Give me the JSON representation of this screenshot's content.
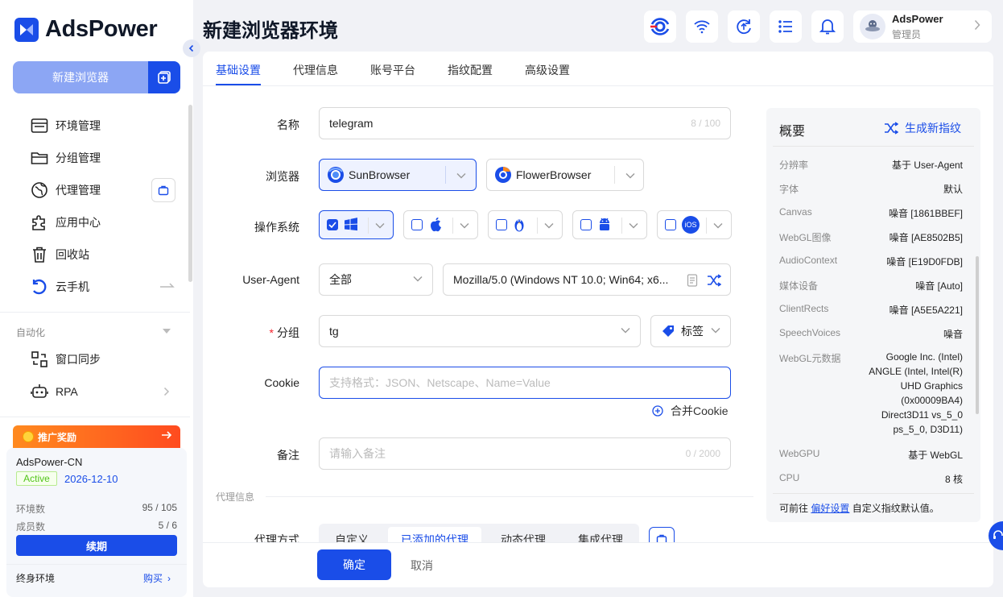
{
  "app": {
    "name": "AdsPower"
  },
  "sidebar": {
    "new_browser_label": "新建浏览器",
    "items": [
      {
        "label": "环境管理"
      },
      {
        "label": "分组管理"
      },
      {
        "label": "代理管理"
      },
      {
        "label": "应用中心"
      },
      {
        "label": "回收站"
      },
      {
        "label": "云手机"
      }
    ],
    "automation_label": "自动化",
    "auto_items": [
      {
        "label": "窗口同步"
      },
      {
        "label": "RPA"
      }
    ],
    "promo_label": "推广奖励",
    "account": {
      "name": "AdsPower-CN",
      "status": "Active",
      "expire": "2026-12-10",
      "env_label": "环境数",
      "env_value": "95 / 105",
      "member_label": "成员数",
      "member_value": "5 / 6",
      "renew_label": "续期",
      "lifetime_label": "终身环境",
      "buy_label": "购买"
    }
  },
  "header": {
    "title": "新建浏览器环境",
    "user": {
      "name": "AdsPower",
      "role": "管理员"
    }
  },
  "tabs": [
    "基础设置",
    "代理信息",
    "账号平台",
    "指纹配置",
    "高级设置"
  ],
  "form": {
    "name_label": "名称",
    "name_value": "telegram",
    "name_count": "8 / 100",
    "browser_label": "浏览器",
    "browser_options": [
      "SunBrowser",
      "FlowerBrowser"
    ],
    "os_label": "操作系统",
    "os_options": [
      "Windows",
      "macOS",
      "Linux",
      "Android",
      "iOS"
    ],
    "os_ios_text": "iOS",
    "ua_label": "User-Agent",
    "ua_scope": "全部",
    "ua_value": "Mozilla/5.0 (Windows NT 10.0; Win64; x6...",
    "group_required": "*",
    "group_label": "分组",
    "group_value": "tg",
    "tag_label": "标签",
    "cookie_label": "Cookie",
    "cookie_placeholder": "支持格式：JSON、Netscape、Name=Value",
    "merge_cookie_label": "合并Cookie",
    "note_label": "备注",
    "note_placeholder": "请输入备注",
    "note_count": "0 / 2000",
    "proxy_section_title": "代理信息",
    "proxy_mode_label": "代理方式",
    "proxy_modes": [
      "自定义",
      "已添加的代理",
      "动态代理",
      "集成代理"
    ]
  },
  "footer": {
    "ok_label": "确定",
    "cancel_label": "取消"
  },
  "overview": {
    "title": "概要",
    "generate_label": "生成新指纹",
    "rows": [
      {
        "k": "分辨率",
        "v": "基于 User-Agent"
      },
      {
        "k": "字体",
        "v": "默认"
      },
      {
        "k": "Canvas",
        "v": "噪音 [1861BBEF]"
      },
      {
        "k": "WebGL图像",
        "v": "噪音 [AE8502B5]"
      },
      {
        "k": "AudioContext",
        "v": "噪音 [E19D0FDB]"
      },
      {
        "k": "媒体设备",
        "v": "噪音 [Auto]"
      },
      {
        "k": "ClientRects",
        "v": "噪音 [A5E5A221]"
      },
      {
        "k": "SpeechVoices",
        "v": "噪音"
      }
    ],
    "webgl_meta_label": "WebGL元数据",
    "webgl_meta_lines": [
      "Google Inc. (Intel)",
      "ANGLE (Intel, Intel(R)",
      "UHD Graphics",
      "(0x00009BA4)",
      "Direct3D11 vs_5_0",
      "ps_5_0, D3D11)"
    ],
    "webgpu_label": "WebGPU",
    "webgpu_value": "基于 WebGL",
    "cpu_label": "CPU",
    "cpu_value": "8 核",
    "footer_prefix": "可前往",
    "footer_link": "偏好设置",
    "footer_suffix": "自定义指纹默认值。"
  },
  "colors": {
    "accent": "#1a4de8",
    "promo": "#ff6a1f",
    "active_green": "#52c41a"
  }
}
